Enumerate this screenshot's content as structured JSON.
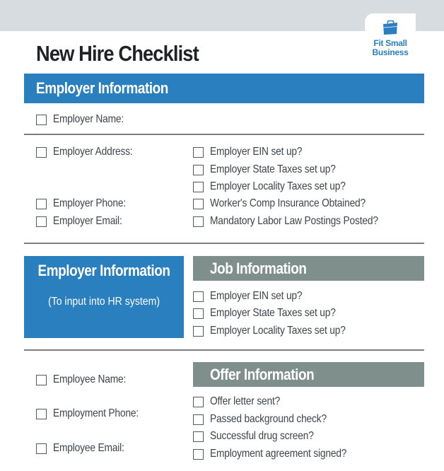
{
  "logo": {
    "icon": "briefcase-icon",
    "line1": "Fit Small",
    "line2": "Business",
    "color": "#2a7fc0"
  },
  "title": "New Hire Checklist",
  "colors": {
    "primary_blue": "#2a7fbf",
    "section_gray": "#7f8f8c",
    "top_band": "#d6dcdf"
  },
  "employer_section": {
    "header": "Employer Information",
    "name_item": {
      "label": "Employer Name:",
      "checked": false
    },
    "left_items": [
      {
        "label": "Employer Address:",
        "checked": false
      },
      {
        "label": "Employer Phone:",
        "checked": false
      },
      {
        "label": "Employer Email:",
        "checked": false
      }
    ],
    "right_items": [
      {
        "label": "Employer EIN set up?",
        "checked": false
      },
      {
        "label": "Employer State Taxes set up?",
        "checked": false
      },
      {
        "label": "Employer Locality Taxes set up?",
        "checked": false
      },
      {
        "label": "Worker's Comp Insurance Obtained?",
        "checked": false
      },
      {
        "label": "Mandatory Labor Law Postings Posted?",
        "checked": false
      }
    ]
  },
  "hr_box": {
    "title": "Employer Information",
    "subtitle": "(To input into HR system)"
  },
  "job_section": {
    "header": "Job Information",
    "items": [
      {
        "label": "Employer EIN set up?",
        "checked": false
      },
      {
        "label": "Employer State Taxes set up?",
        "checked": false
      },
      {
        "label": "Employer Locality Taxes set up?",
        "checked": false
      }
    ]
  },
  "employee_section": {
    "items": [
      {
        "label": "Employee Name:",
        "checked": false
      },
      {
        "label": "Employment Phone:",
        "checked": false
      },
      {
        "label": "Employee Email:",
        "checked": false
      }
    ]
  },
  "offer_section": {
    "header": "Offer Information",
    "items": [
      {
        "label": "Offer letter sent?",
        "checked": false
      },
      {
        "label": "Passed background check?",
        "checked": false
      },
      {
        "label": "Successful drug screen?",
        "checked": false
      },
      {
        "label": "Employment agreement signed?",
        "checked": false
      }
    ]
  }
}
